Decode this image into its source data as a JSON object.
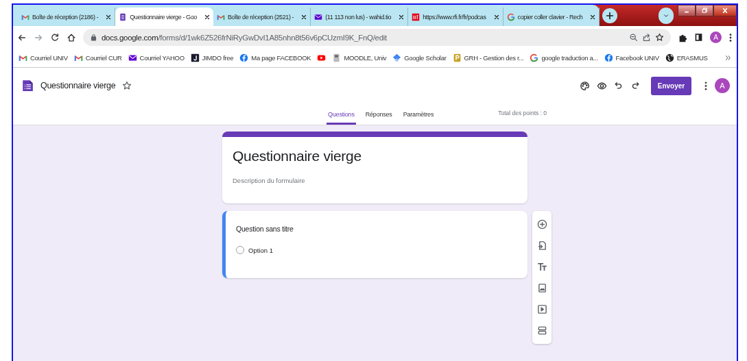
{
  "browser": {
    "tabs": [
      {
        "title": "Boîte de réception (2186) -",
        "kind": "gmail",
        "selected": false
      },
      {
        "title": "Questionnaire vierge - Goo",
        "kind": "forms",
        "selected": true
      },
      {
        "title": "Boîte de réception (2521) -",
        "kind": "gmail",
        "selected": false
      },
      {
        "title": "(11 113 non lus) - wahid.tio",
        "kind": "yahoo",
        "selected": false
      },
      {
        "title": "https://www.rfi.fr/fr/podcas",
        "kind": "rfi",
        "selected": false
      },
      {
        "title": "copier coller clavier - Rech",
        "kind": "google",
        "selected": false
      }
    ],
    "url": {
      "host": "docs.google.com",
      "path": "/forms/d/1wk6Z526frNiRyGwDvI1A85nhn8t56v6pCUzmI9K_FnQ/edit"
    },
    "profile_initial": "A",
    "bookmarks": [
      {
        "label": "Courriel UNIV",
        "kind": "gmail"
      },
      {
        "label": "Courriel CUR",
        "kind": "gmail"
      },
      {
        "label": "Courriel YAHOO",
        "kind": "yahoo"
      },
      {
        "label": "JIMDO free",
        "kind": "jimdo"
      },
      {
        "label": "Ma page FACEBOOK",
        "kind": "facebook"
      },
      {
        "kind": "youtube"
      },
      {
        "label": "MOODLE, Univ",
        "kind": "moodle"
      },
      {
        "label": "Google Scholar",
        "kind": "scholar"
      },
      {
        "label": "GRH - Gestion des r...",
        "kind": "grh"
      },
      {
        "label": "google traduction a...",
        "kind": "google"
      },
      {
        "label": "Facebook UNIV",
        "kind": "facebook"
      },
      {
        "label": "ERASMUS",
        "kind": "globe"
      }
    ]
  },
  "forms": {
    "title": "Questionnaire vierge",
    "send_button": "Envoyer",
    "avatar_initial": "A",
    "nav_tabs": [
      {
        "label": "Questions",
        "selected": true
      },
      {
        "label": "Réponses",
        "selected": false
      },
      {
        "label": "Paramètres",
        "selected": false
      }
    ],
    "total_points": "Total des points : 0",
    "form_title": "Questionnaire vierge",
    "form_description": "Description du formulaire",
    "questions": [
      {
        "title": "Question sans titre",
        "active": true,
        "options": [
          {
            "label": "Option 1",
            "selected": false
          }
        ]
      }
    ]
  }
}
